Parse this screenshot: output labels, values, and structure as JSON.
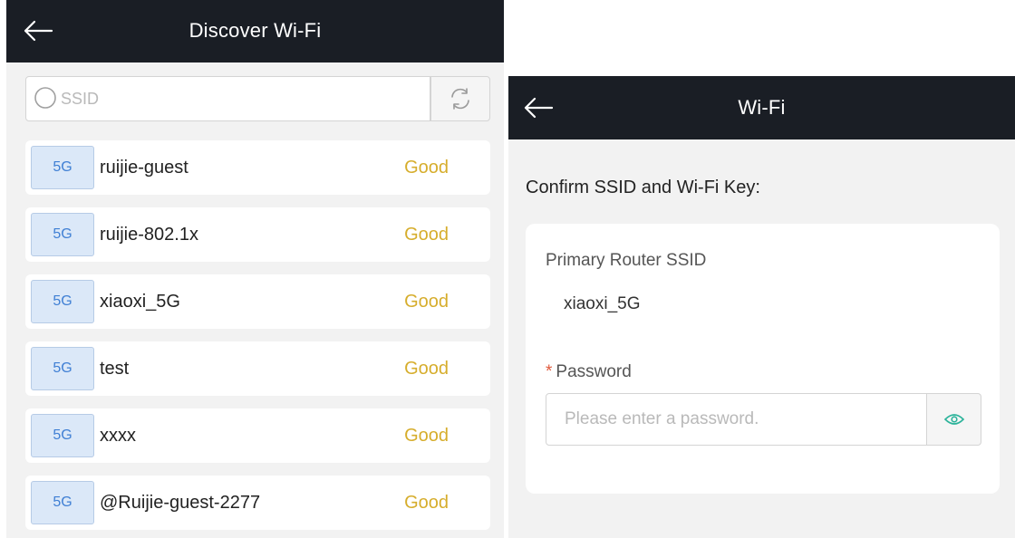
{
  "discover": {
    "title": "Discover Wi-Fi",
    "search": {
      "placeholder": "SSID",
      "value": ""
    },
    "networks": [
      {
        "band": "5G",
        "ssid": "ruijie-guest",
        "signal": "Good"
      },
      {
        "band": "5G",
        "ssid": "ruijie-802.1x",
        "signal": "Good"
      },
      {
        "band": "5G",
        "ssid": "xiaoxi_5G",
        "signal": "Good"
      },
      {
        "band": "5G",
        "ssid": "test",
        "signal": "Good"
      },
      {
        "band": "5G",
        "ssid": "xxxx",
        "signal": "Good"
      },
      {
        "band": "5G",
        "ssid": "@Ruijie-guest-2277",
        "signal": "Good"
      }
    ]
  },
  "wifi": {
    "title": "Wi-Fi",
    "confirm_label": "Confirm SSID and Wi-Fi Key:",
    "primary_ssid_label": "Primary Router SSID",
    "primary_ssid_value": "xiaoxi_5G",
    "password_required_mark": "*",
    "password_label": "Password",
    "password_placeholder": "Please enter a password.",
    "password_value": ""
  },
  "colors": {
    "header_bg": "#1a1e25",
    "signal_good": "#d6ad2c",
    "badge_bg": "#dbe8f8",
    "badge_text": "#3f7fd4",
    "eye_icon": "#2bb39a",
    "required_mark": "#e05a3d"
  },
  "icons": {
    "back": "arrow-left-icon",
    "search": "search-icon",
    "refresh": "refresh-icon",
    "eye": "eye-icon"
  }
}
